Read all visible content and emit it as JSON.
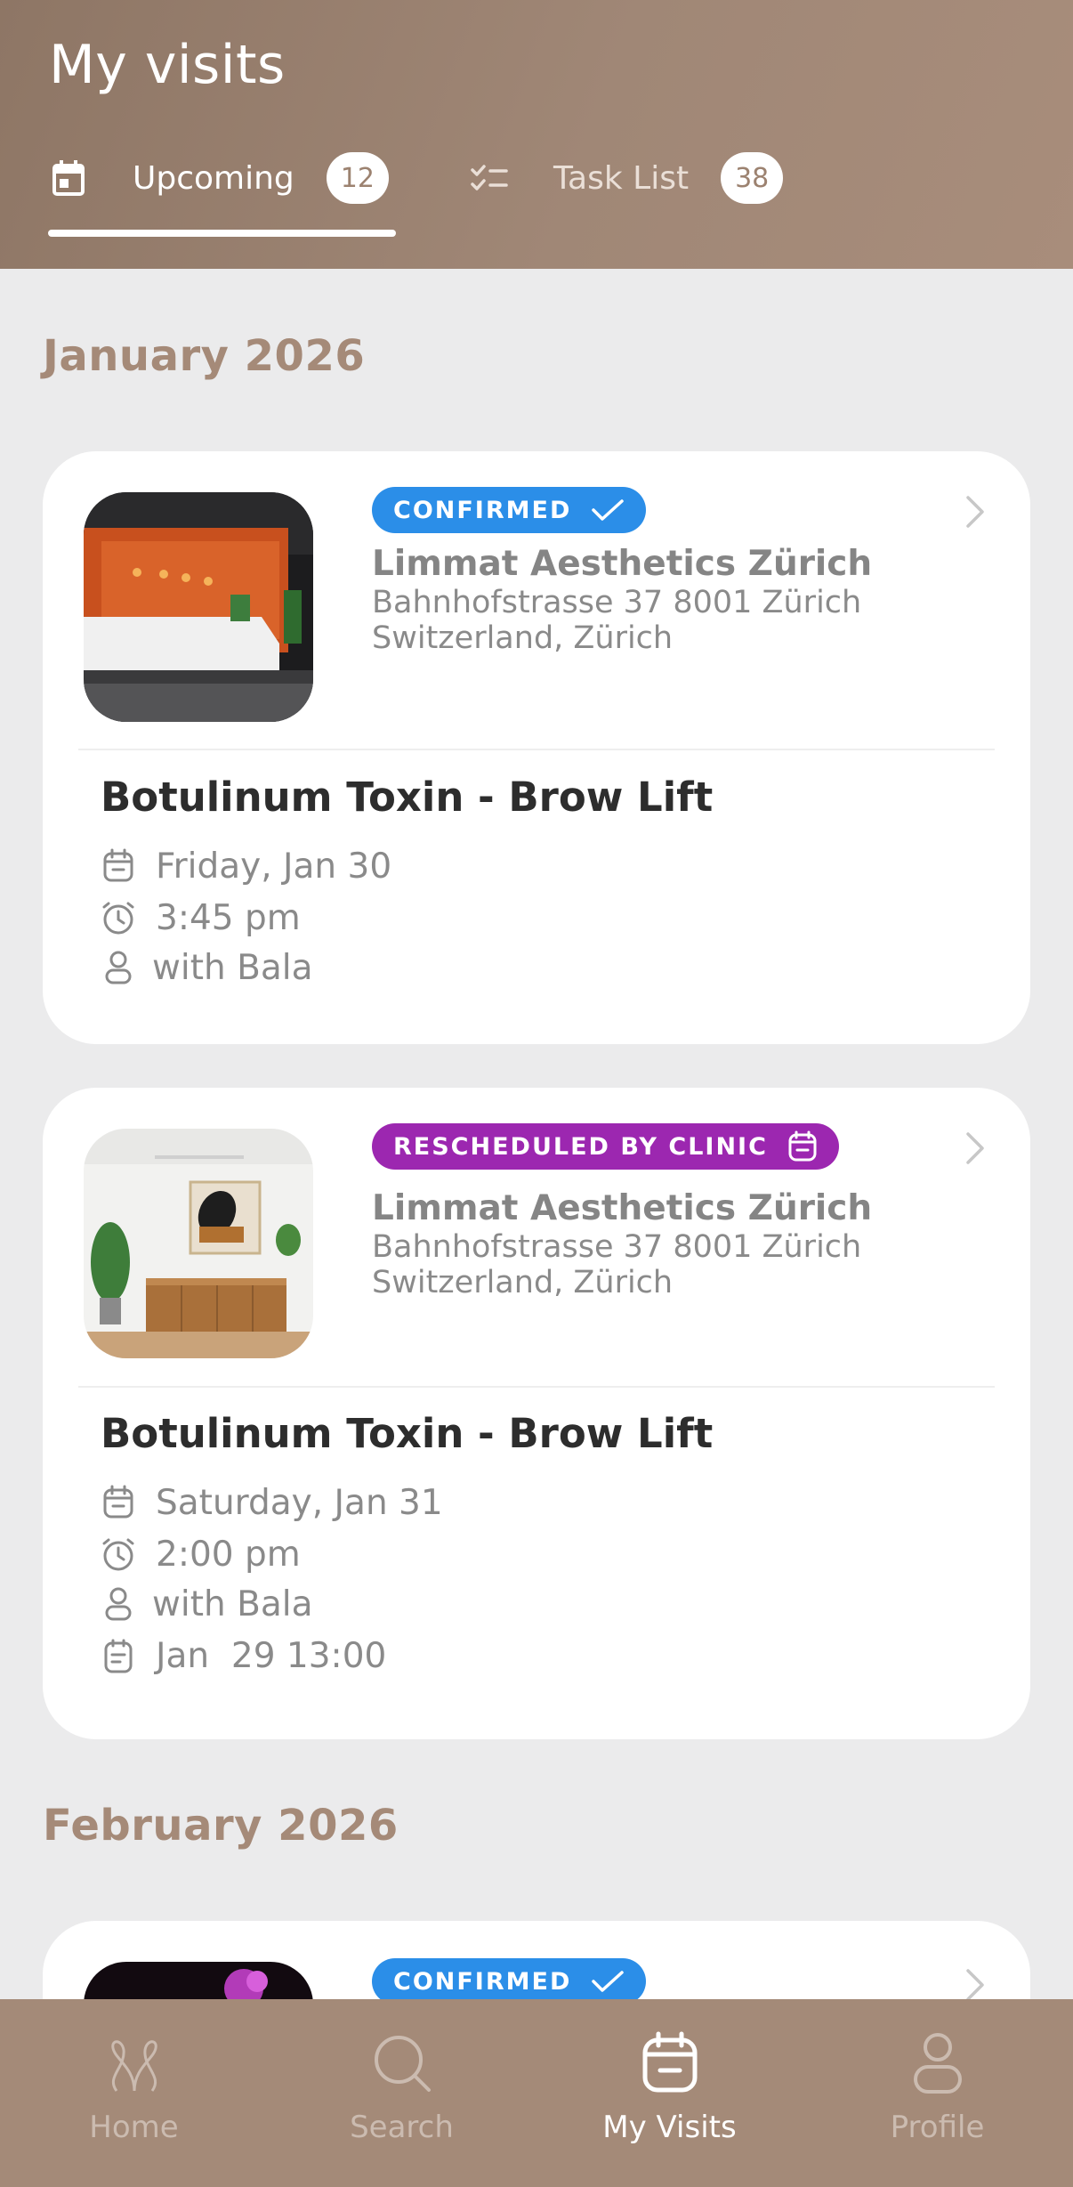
{
  "header": {
    "title": "My visits",
    "tabs": [
      {
        "label": "Upcoming",
        "count": "12",
        "icon": "calendar-icon",
        "active": true
      },
      {
        "label": "Task List",
        "count": "38",
        "icon": "checklist-icon",
        "active": false
      }
    ]
  },
  "sections": [
    {
      "month": "January 2026"
    },
    {
      "month": "February 2026"
    }
  ],
  "visits": [
    {
      "status": "CONFIRMED",
      "status_icon": "check-icon",
      "clinic_name": "Limmat Aesthetics Zürich",
      "address_line1": "Bahnhofstrasse 37 8001 Zürich",
      "address_line2": "Switzerland, Zürich",
      "service": "Botulinum Toxin - Brow Lift",
      "date": "Friday, Jan 30",
      "time": "3:45 pm",
      "provider": "with Bala"
    },
    {
      "status": "RESCHEDULED BY CLINIC",
      "status_icon": "calendar-icon",
      "clinic_name": "Limmat Aesthetics Zürich",
      "address_line1": "Bahnhofstrasse 37 8001 Zürich",
      "address_line2": "Switzerland, Zürich",
      "service": "Botulinum Toxin - Brow Lift",
      "date": "Saturday, Jan 31",
      "time": "2:00 pm",
      "provider": "with Bala",
      "note": "Jan  29 13:00"
    },
    {
      "status": "CONFIRMED",
      "status_icon": "check-icon"
    }
  ],
  "bottom_nav": [
    {
      "label": "Home",
      "icon": "home-icon",
      "active": false
    },
    {
      "label": "Search",
      "icon": "search-icon",
      "active": false
    },
    {
      "label": "My Visits",
      "icon": "calendar-icon",
      "active": true
    },
    {
      "label": "Profile",
      "icon": "profile-icon",
      "active": false
    }
  ],
  "colors": {
    "header": "#a08776",
    "accent": "#a58a78",
    "confirmed": "#2b8ee8",
    "rescheduled": "#9c27b0",
    "nav_bg": "#a48a78"
  }
}
